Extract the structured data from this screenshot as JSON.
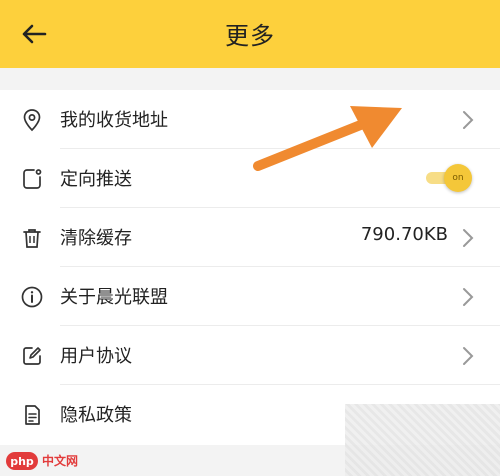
{
  "header": {
    "title": "更多",
    "back_icon": "back-arrow-icon",
    "bg_color": "#fdd03c"
  },
  "items": [
    {
      "label": "我的收货地址",
      "icon": "location-pin-icon",
      "value": "",
      "control": "chevron"
    },
    {
      "label": "定向推送",
      "icon": "push-icon",
      "value": "",
      "control": "toggle",
      "toggle_state": "on",
      "toggle_text": "on"
    },
    {
      "label": "清除缓存",
      "icon": "trash-icon",
      "value": "790.70KB",
      "control": "chevron"
    },
    {
      "label": "关于晨光联盟",
      "icon": "info-icon",
      "value": "",
      "control": "chevron"
    },
    {
      "label": "用户协议",
      "icon": "edit-icon",
      "value": "",
      "control": "chevron"
    },
    {
      "label": "隐私政策",
      "icon": "document-icon",
      "value": "",
      "control": "none"
    }
  ],
  "annotation": {
    "icon": "orange-arrow-icon",
    "color": "#f08a30"
  },
  "watermark": {
    "logo_text": "php",
    "site_text": "中文网",
    "color": "#e23b3b"
  }
}
